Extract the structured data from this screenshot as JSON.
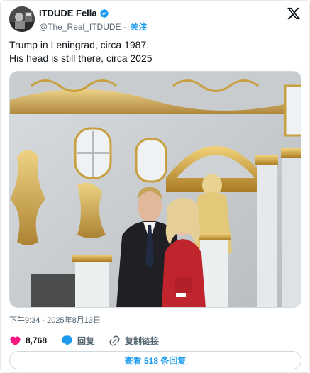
{
  "author": {
    "display_name": "ITDUDE Fella",
    "handle": "@The_Real_ITDUDE",
    "separator": "·",
    "follow_label": "关注"
  },
  "tweet": {
    "text_lines": [
      "Trump in Leningrad, circa 1987.",
      "His head is still there, circa 2025"
    ]
  },
  "meta": {
    "timestamp": "下午9:34 · 2025年8月13日"
  },
  "actions": {
    "like_count": "8,768",
    "reply_label": "回复",
    "copy_link_label": "复制链接"
  },
  "replies_button": {
    "label": "查看 518 条回复"
  },
  "colors": {
    "accent": "#1d9bf0",
    "like": "#f91880",
    "text": "#0f1419",
    "muted": "#536471"
  },
  "icons": {
    "verified": "verified-badge-icon",
    "platform": "x-logo-icon",
    "like": "heart-icon",
    "reply": "speech-bubble-icon",
    "copy_link": "link-icon"
  }
}
